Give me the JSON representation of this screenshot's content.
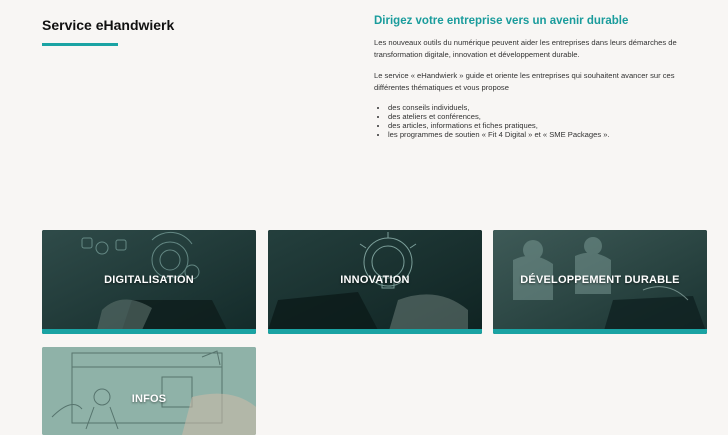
{
  "page": {
    "title": "Service eHandwierk"
  },
  "intro": {
    "heading": "Dirigez votre entreprise vers un avenir durable",
    "paragraph1": "Les nouveaux outils du numérique peuvent aider les entreprises dans leurs démarches de transformation digitale, innovation et développement durable.",
    "paragraph2": "Le service « eHandwierk » guide et oriente les entreprises qui souhaitent avancer sur ces différentes thématiques et vous propose",
    "bullets": [
      "des conseils individuels,",
      "des ateliers et conférences,",
      "des articles, informations et fiches pratiques,",
      "les programmes de soutien « Fit 4 Digital » et « SME Packages »."
    ]
  },
  "cards": [
    {
      "label": "DIGITALISATION"
    },
    {
      "label": "INNOVATION"
    },
    {
      "label": "DÉVELOPPEMENT DURABLE"
    },
    {
      "label": "INFOS"
    }
  ],
  "colors": {
    "accent": "#1aa3a3",
    "card_dark": "#1f3d3c",
    "card_light": "#8fb2a8"
  }
}
